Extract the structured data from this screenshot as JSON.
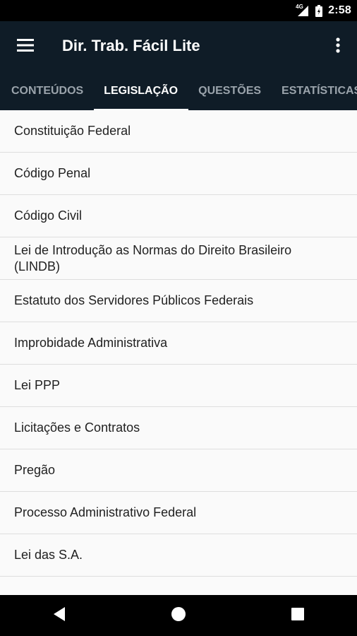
{
  "status_bar": {
    "network": "4G",
    "time": "2:58"
  },
  "app_bar": {
    "title": "Dir. Trab. Fácil Lite",
    "menu_icon": "hamburger-menu-icon",
    "overflow_icon": "more-vert-icon"
  },
  "tabs": [
    {
      "label": "CONTEÚDOS",
      "active": false
    },
    {
      "label": "LEGISLAÇÃO",
      "active": true
    },
    {
      "label": "QUESTÕES",
      "active": false
    },
    {
      "label": "ESTATÍSTICAS",
      "active": false
    }
  ],
  "list": {
    "items": [
      {
        "label": "Constituição Federal"
      },
      {
        "label": "Código Penal"
      },
      {
        "label": "Código Civil"
      },
      {
        "label": "Lei de Introdução as Normas do Direito Brasileiro (LINDB)"
      },
      {
        "label": "Estatuto dos Servidores Públicos Federais"
      },
      {
        "label": "Improbidade Administrativa"
      },
      {
        "label": "Lei PPP"
      },
      {
        "label": "Licitações e Contratos"
      },
      {
        "label": "Pregão"
      },
      {
        "label": "Processo Administrativo Federal"
      },
      {
        "label": "Lei das S.A."
      },
      {
        "label": ""
      }
    ]
  },
  "nav_bar": {
    "back_icon": "back-icon",
    "home_icon": "home-icon",
    "recents_icon": "recents-icon"
  },
  "colors": {
    "app_bar": "#0f1c27",
    "tab_inactive": "#9aa3ab",
    "tab_active": "#ffffff",
    "list_background": "#fafafa",
    "divider": "#dedede"
  }
}
